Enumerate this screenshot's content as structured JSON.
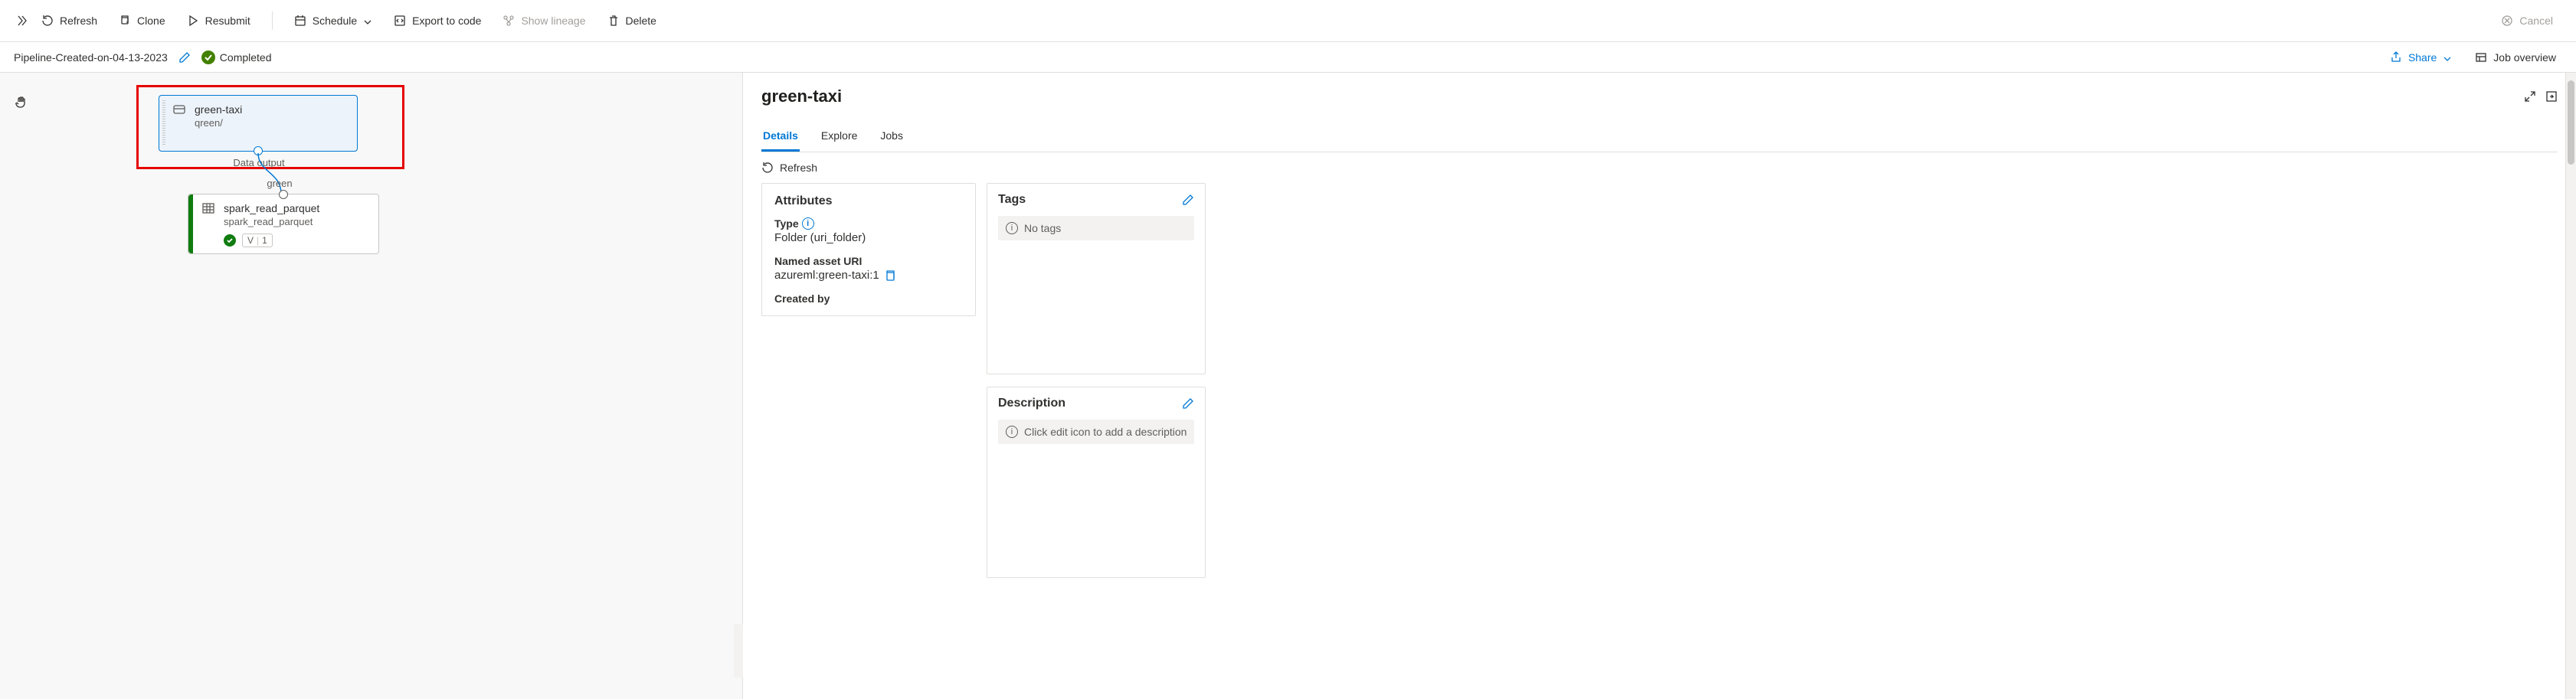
{
  "toolbar": {
    "refresh": "Refresh",
    "clone": "Clone",
    "resubmit": "Resubmit",
    "schedule": "Schedule",
    "export": "Export to code",
    "lineage": "Show lineage",
    "delete": "Delete",
    "cancel": "Cancel"
  },
  "subheader": {
    "pipeline_name": "Pipeline-Created-on-04-13-2023",
    "status": "Completed",
    "share": "Share",
    "overview": "Job overview"
  },
  "canvas": {
    "node1": {
      "title": "green-taxi",
      "sub": "qreen/",
      "output_label": "Data output"
    },
    "edge_label": "green",
    "node2": {
      "title": "spark_read_parquet",
      "sub": "spark_read_parquet",
      "version": "1",
      "version_prefix": "V"
    }
  },
  "details": {
    "title": "green-taxi",
    "tabs": {
      "details": "Details",
      "explore": "Explore",
      "jobs": "Jobs"
    },
    "refresh": "Refresh",
    "attributes": {
      "heading": "Attributes",
      "type_label": "Type",
      "type_value": "Folder (uri_folder)",
      "uri_label": "Named asset URI",
      "uri_value": "azureml:green-taxi:1",
      "createdby_label": "Created by"
    },
    "tags": {
      "heading": "Tags",
      "empty": "No tags"
    },
    "description": {
      "heading": "Description",
      "empty": "Click edit icon to add a description"
    }
  }
}
